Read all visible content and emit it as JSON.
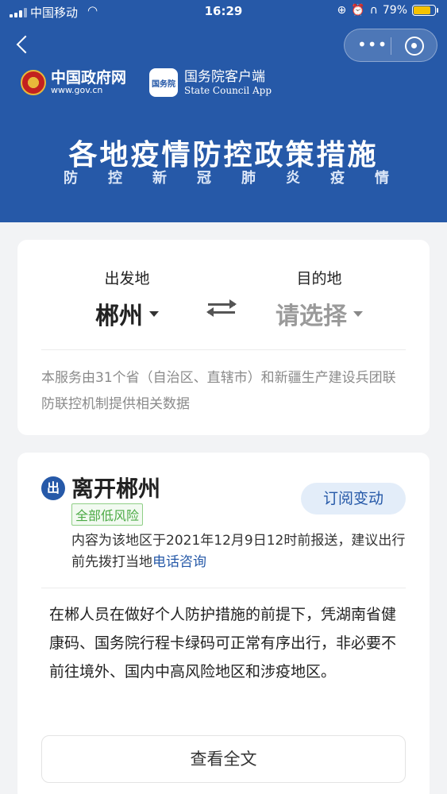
{
  "status_bar": {
    "carrier": "中国移动",
    "time": "16:29",
    "battery_text": "79%",
    "battery_level": 0.79,
    "battery_color": "#f5c200"
  },
  "header": {
    "brand_gov": {
      "name": "中国政府网",
      "url": "www.gov.cn"
    },
    "brand_app": {
      "icon_text": "国务院",
      "name": "国务院客户端",
      "en": "State Council App"
    },
    "title": "各地疫情防控政策措施",
    "subtitle": [
      "防",
      "控",
      "新",
      "冠",
      "肺",
      "炎",
      "疫",
      "情"
    ],
    "accent": "#2659a8"
  },
  "route": {
    "from_label": "出发地",
    "from_value": "郴州",
    "to_label": "目的地",
    "to_value": "请选择",
    "note": "本服务由31个省（自治区、直辖市）和新疆生产建设兵团联防联控机制提供相关数据"
  },
  "departure": {
    "badge": "出",
    "title": "离开郴州",
    "risk": "全部低风险",
    "subscribe": "订阅变动",
    "report_text": "内容为该地区于2021年12月9日12时前报送，建议出行前先拨打当地",
    "report_link": "电话咨询",
    "policy": "在郴人员在做好个人防护措施的前提下，凭湖南省健康码、国务院行程卡绿码可正常有序出行，非必要不前往境外、国内中高风险地区和涉疫地区。",
    "full_text_button": "查看全文"
  }
}
